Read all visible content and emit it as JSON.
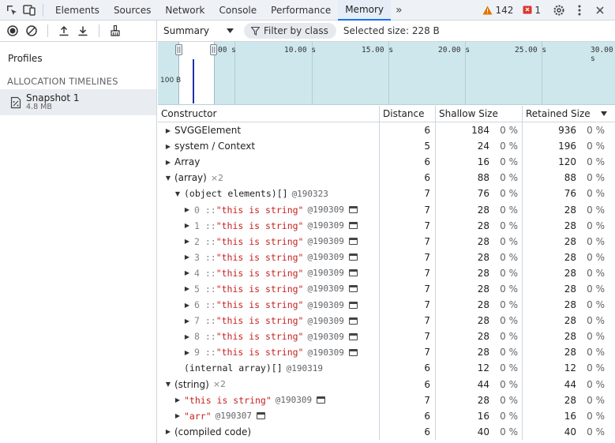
{
  "tabs": [
    "Elements",
    "Sources",
    "Network",
    "Console",
    "Performance",
    "Memory"
  ],
  "active_tab": "Memory",
  "warnings": "142",
  "errors": "1",
  "sidebar": {
    "profiles_label": "Profiles",
    "section": "ALLOCATION TIMELINES",
    "snapshot": {
      "name": "Snapshot 1",
      "size": "4.8 MB"
    }
  },
  "toolbar": {
    "view": "Summary",
    "filter": "Filter by class",
    "selected_size": "Selected size: 228 B"
  },
  "timeline": {
    "ticks": [
      "00 s",
      "10.00 s",
      "15.00 s",
      "20.00 s",
      "25.00 s",
      "30.00 s"
    ],
    "y_label": "100 B"
  },
  "columns": [
    "Constructor",
    "Distance",
    "Shallow Size",
    "Retained Size"
  ],
  "rows": [
    {
      "label": "SVGGElement",
      "distance": "6",
      "shallow": "184",
      "shallow_pct": "0 %",
      "retained": "936",
      "retained_pct": "0 %"
    },
    {
      "label": "system / Context",
      "distance": "5",
      "shallow": "24",
      "shallow_pct": "0 %",
      "retained": "196",
      "retained_pct": "0 %"
    },
    {
      "label": "Array",
      "distance": "6",
      "shallow": "16",
      "shallow_pct": "0 %",
      "retained": "120",
      "retained_pct": "0 %"
    },
    {
      "label": "(array)",
      "mult": "×2",
      "distance": "6",
      "shallow": "88",
      "shallow_pct": "0 %",
      "retained": "88",
      "retained_pct": "0 %"
    },
    {
      "label": "(object elements)[]",
      "addr": "@190323",
      "distance": "7",
      "shallow": "76",
      "shallow_pct": "0 %",
      "retained": "76",
      "retained_pct": "0 %"
    },
    {
      "idx": "0",
      "sep": " :: ",
      "str": "\"this is string\"",
      "addr": "@190309",
      "distance": "7",
      "shallow": "28",
      "shallow_pct": "0 %",
      "retained": "28",
      "retained_pct": "0 %"
    },
    {
      "idx": "1",
      "sep": " :: ",
      "str": "\"this is string\"",
      "addr": "@190309",
      "distance": "7",
      "shallow": "28",
      "shallow_pct": "0 %",
      "retained": "28",
      "retained_pct": "0 %"
    },
    {
      "idx": "2",
      "sep": " :: ",
      "str": "\"this is string\"",
      "addr": "@190309",
      "distance": "7",
      "shallow": "28",
      "shallow_pct": "0 %",
      "retained": "28",
      "retained_pct": "0 %"
    },
    {
      "idx": "3",
      "sep": " :: ",
      "str": "\"this is string\"",
      "addr": "@190309",
      "distance": "7",
      "shallow": "28",
      "shallow_pct": "0 %",
      "retained": "28",
      "retained_pct": "0 %"
    },
    {
      "idx": "4",
      "sep": " :: ",
      "str": "\"this is string\"",
      "addr": "@190309",
      "distance": "7",
      "shallow": "28",
      "shallow_pct": "0 %",
      "retained": "28",
      "retained_pct": "0 %"
    },
    {
      "idx": "5",
      "sep": " :: ",
      "str": "\"this is string\"",
      "addr": "@190309",
      "distance": "7",
      "shallow": "28",
      "shallow_pct": "0 %",
      "retained": "28",
      "retained_pct": "0 %"
    },
    {
      "idx": "6",
      "sep": " :: ",
      "str": "\"this is string\"",
      "addr": "@190309",
      "distance": "7",
      "shallow": "28",
      "shallow_pct": "0 %",
      "retained": "28",
      "retained_pct": "0 %"
    },
    {
      "idx": "7",
      "sep": " :: ",
      "str": "\"this is string\"",
      "addr": "@190309",
      "distance": "7",
      "shallow": "28",
      "shallow_pct": "0 %",
      "retained": "28",
      "retained_pct": "0 %"
    },
    {
      "idx": "8",
      "sep": " :: ",
      "str": "\"this is string\"",
      "addr": "@190309",
      "distance": "7",
      "shallow": "28",
      "shallow_pct": "0 %",
      "retained": "28",
      "retained_pct": "0 %"
    },
    {
      "idx": "9",
      "sep": " :: ",
      "str": "\"this is string\"",
      "addr": "@190309",
      "distance": "7",
      "shallow": "28",
      "shallow_pct": "0 %",
      "retained": "28",
      "retained_pct": "0 %"
    },
    {
      "label": "(internal array)[]",
      "addr": "@190319",
      "distance": "6",
      "shallow": "12",
      "shallow_pct": "0 %",
      "retained": "12",
      "retained_pct": "0 %"
    },
    {
      "label": "(string)",
      "mult": "×2",
      "distance": "6",
      "shallow": "44",
      "shallow_pct": "0 %",
      "retained": "44",
      "retained_pct": "0 %"
    },
    {
      "str": "\"this is string\"",
      "addr": "@190309",
      "distance": "7",
      "shallow": "28",
      "shallow_pct": "0 %",
      "retained": "28",
      "retained_pct": "0 %"
    },
    {
      "str": "\"arr\"",
      "addr": "@190307",
      "distance": "6",
      "shallow": "16",
      "shallow_pct": "0 %",
      "retained": "16",
      "retained_pct": "0 %"
    },
    {
      "label": "(compiled code)",
      "distance": "6",
      "shallow": "40",
      "shallow_pct": "0 %",
      "retained": "40",
      "retained_pct": "0 %"
    }
  ]
}
